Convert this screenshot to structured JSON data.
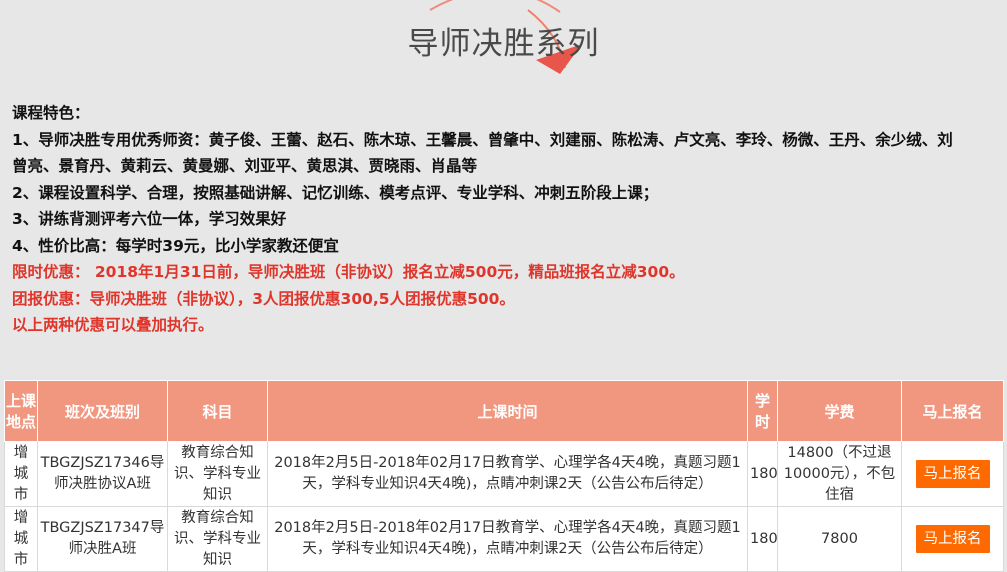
{
  "page": {
    "title": "导师决胜系列"
  },
  "features": {
    "heading": "课程特色：",
    "items": [
      "1、导师决胜专用优秀师资：黄子俊、王蕾、赵石、陈木琼、王馨晨、曾肇中、刘建丽、陈松涛、卢文亮、李玲、杨微、王丹、余少绒、刘",
      "曾亮、景育丹、黄莉云、黄曼娜、刘亚平、黄思淇、贾晓雨、肖晶等",
      "2、课程设置科学、合理，按照基础讲解、记忆训练、模考点评、专业学科、冲刺五阶段上课；",
      "3、讲练背测评考六位一体，学习效果好",
      "4、性价比高：每学时39元，比小学家教还便宜"
    ],
    "promo_1": "限时优惠： 2018年1月31日前，导师决胜班（非协议）报名立减500元，精品班报名立减300。",
    "promo_2": "团报优惠：导师决胜班（非协议），3人团报优惠300,5人团报优惠500。",
    "promo_3": "以上两种优惠可以叠加执行。"
  },
  "table": {
    "headers": [
      "上课地点",
      "班次及班别",
      "科目",
      "上课时间",
      "学时",
      "学费",
      "马上报名"
    ],
    "rows": [
      {
        "location": "增城市",
        "class_name": "TBGZJSZ17346导师决胜协议A班",
        "subject": "教育综合知识、学科专业知识",
        "time": "2018年2月5日-2018年02月17日教育学、心理学各4天4晚，真题习题1天，学科专业知识4天4晚)，点睛冲刺课2天（公告公布后待定）",
        "hours": "180",
        "fee": "14800（不过退10000元），不包住宿",
        "button": "马上报名"
      },
      {
        "location": "增城市",
        "class_name": "TBGZJSZ17347导师决胜A班",
        "subject": "教育综合知识、学科专业知识",
        "time": "2018年2月5日-2018年02月17日教育学、心理学各4天4晚，真题习题1天，学科专业知识4天4晚)，点睛冲刺课2天（公告公布后待定）",
        "hours": "180",
        "fee": "7800",
        "button": "马上报名"
      }
    ]
  }
}
